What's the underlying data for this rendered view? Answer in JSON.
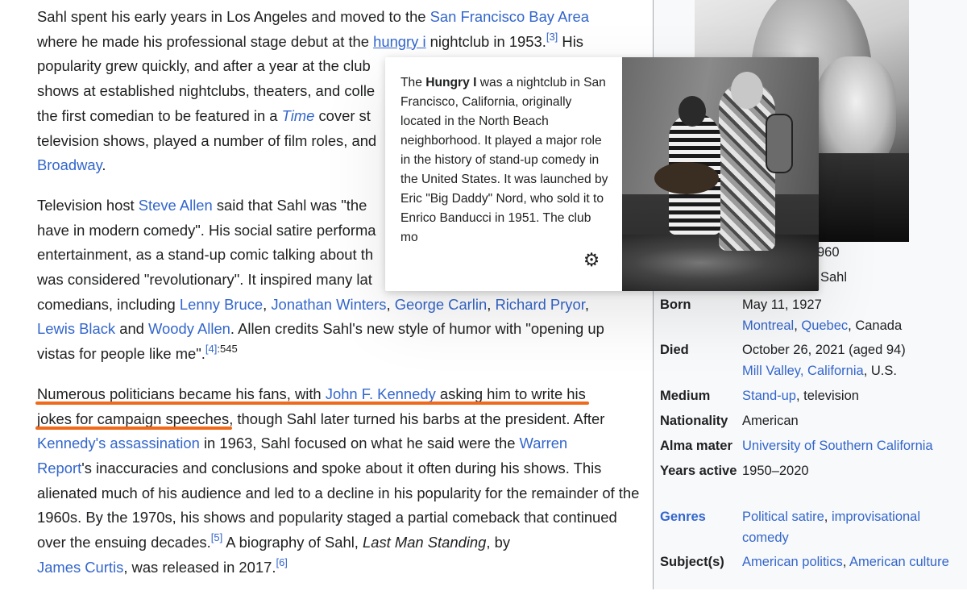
{
  "article": {
    "p1": {
      "t1": "Sahl spent his early years in Los Angeles and moved to the ",
      "l_sfba": "San Francisco Bay Area",
      "t2": " where he made his professional stage debut at the ",
      "l_hungry": "hungry i",
      "t3": " nightclub in 1953.",
      "r3": "[3]",
      "t4": " His popularity grew quickly, and after a year at the club",
      "t5": " shows at established nightclubs, theaters, and colle",
      "t6": " the first comedian to be featured in a ",
      "l_time": "Time",
      "t7": " cover st",
      "t8": " television shows, played a number of film roles, and",
      "l_broadway": "Broadway",
      "t9": "."
    },
    "p2": {
      "t1": "Television host ",
      "l_steve": "Steve Allen",
      "t2": " said that Sahl was \"the",
      "t3": " have in modern comedy\". His social satire performa",
      "t4": " entertainment, as a stand-up comic talking about th",
      "t5": " was considered \"revolutionary\". It inspired many lat",
      "t6": " comedians, including ",
      "l_lenny": "Lenny Bruce",
      "c1": ", ",
      "l_jonathan": "Jonathan Winters",
      "c2": ", ",
      "l_carlin": "George Carlin",
      "c3": ", ",
      "l_pryor": "Richard Pryor",
      "c4": ",",
      "l_black": "Lewis Black",
      "t7": " and ",
      "l_woody": "Woody Allen",
      "t8": ". Allen credits Sahl's new style of humor with \"opening up vistas for people like me\".",
      "r4": "[4]",
      "p4": ":545"
    },
    "p3": {
      "u1": "Numerous politicians became his fans,",
      "u2": " with ",
      "l_jfk": "John F. Kennedy",
      "u3": " asking him to write his",
      "u4": "jokes for campaign speeches",
      "t1": ", though Sahl later turned his barbs at the president. After",
      "l_assassination": "Kennedy's assassination",
      "t2": " in 1963, Sahl focused on what he said were the ",
      "l_warren1": "Warren",
      "l_warren2": "Report",
      "t3": "'s inaccuracies and conclusions and spoke about it often during his shows. This alienated much of his audience and led to a decline in his popularity for the remainder of the 1960s. By the 1970s, his shows and popularity staged a partial comeback that continued over the ensuing decades.",
      "r5": "[5]",
      "t4": " A biography of Sahl, ",
      "book": "Last Man Standing",
      "t5": ", by",
      "l_curtis": "James Curtis",
      "t6": ", was released in 2017.",
      "r6": "[6]"
    }
  },
  "popup": {
    "t1": "The ",
    "bold": "Hungry I",
    "t2": " was a nightclub in San Francisco, California, originally located in the North Beach neighborhood. It played a major role in the history of stand-up comedy in the United States. It was launched by Eric \"Big Daddy\" Nord, who sold it to Enrico Banducci in 1951. The club mo",
    "settings_icon": "gear-icon"
  },
  "infobox": {
    "caption_year": "960",
    "caption_name": "Sahl",
    "rows": [
      {
        "label": "Born",
        "value": "May 11, 1927",
        "links": [
          "Montreal",
          "Quebec"
        ],
        "tail": ", Canada"
      },
      {
        "label": "Died",
        "value": "October 26, 2021 (aged 94)",
        "link": "Mill Valley, California",
        "tail": ", U.S."
      },
      {
        "label": "Medium",
        "link": "Stand-up",
        "tail": ", television"
      },
      {
        "label": "Nationality",
        "value": "American"
      },
      {
        "label": "Alma mater",
        "link": "University of Southern California"
      },
      {
        "label": "Years active",
        "value": "1950–2020"
      },
      {
        "label": "Genres",
        "links": [
          "Political satire",
          "improvisational comedy"
        ]
      },
      {
        "label": "Subject(s)",
        "links": [
          "American politics",
          "American culture"
        ]
      }
    ]
  }
}
